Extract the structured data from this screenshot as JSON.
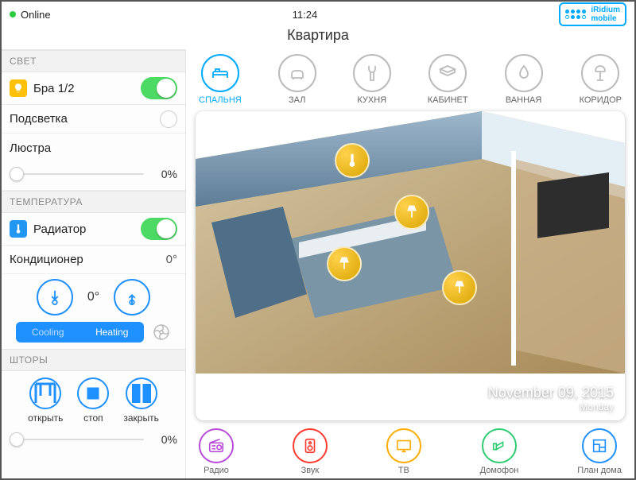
{
  "status": {
    "online": "Online",
    "time": "11:24",
    "brand1": "iRidium",
    "brand2": "mobile"
  },
  "title": "Квартира",
  "sections": {
    "light": "СВЕТ",
    "temp": "ТЕМПЕРАТУРА",
    "curtains": "ШТОРЫ"
  },
  "light": {
    "bra": "Бра 1/2",
    "backlight": "Подсветка",
    "chandelier": "Люстра",
    "chandelier_pct": "0%"
  },
  "temp": {
    "radiator": "Радиатор",
    "ac": "Кондиционер",
    "ac_val": "0°",
    "current": "0°",
    "cooling": "Cooling",
    "heating": "Heating"
  },
  "curtains": {
    "open": "открыть",
    "stop": "стоп",
    "close": "закрыть",
    "pct": "0%"
  },
  "rooms": [
    {
      "id": "bedroom",
      "label": "СПАЛЬНЯ",
      "active": true
    },
    {
      "id": "hall",
      "label": "ЗАЛ"
    },
    {
      "id": "kitchen",
      "label": "КУХНЯ"
    },
    {
      "id": "cabinet",
      "label": "КАБИНЕТ"
    },
    {
      "id": "bath",
      "label": "ВАННАЯ"
    },
    {
      "id": "corridor",
      "label": "КОРИДОР"
    }
  ],
  "date": {
    "full": "November 09, 2015",
    "day": "Monday"
  },
  "bottom": [
    {
      "id": "radio",
      "label": "Радио",
      "color": "#b84bd8"
    },
    {
      "id": "sound",
      "label": "Звук",
      "color": "#ff3b30"
    },
    {
      "id": "tv",
      "label": "ТВ",
      "color": "#ffab00"
    },
    {
      "id": "intercom",
      "label": "Домофон",
      "color": "#2ecc71"
    },
    {
      "id": "plan",
      "label": "План дома",
      "color": "#1e90ff"
    }
  ]
}
